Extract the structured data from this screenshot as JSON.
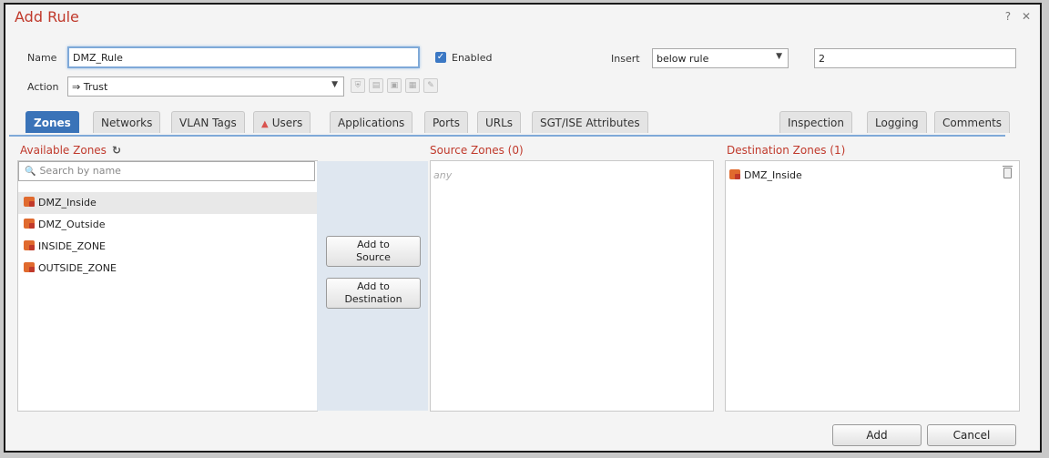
{
  "dialog": {
    "title": "Add Rule",
    "help_label": "?",
    "close_label": "✕"
  },
  "form": {
    "name_label": "Name",
    "name_value": "DMZ_Rule",
    "enabled_label": "Enabled",
    "enabled_checked": true,
    "insert_label": "Insert",
    "insert_value": "below rule",
    "insert_index": "2",
    "action_label": "Action",
    "action_value": "⇒ Trust"
  },
  "tabs": [
    {
      "label": "Zones",
      "active": true
    },
    {
      "label": "Networks"
    },
    {
      "label": "VLAN Tags"
    },
    {
      "label": "Users",
      "warning": true
    },
    {
      "label": "Applications"
    },
    {
      "label": "Ports"
    },
    {
      "label": "URLs"
    },
    {
      "label": "SGT/ISE Attributes"
    },
    {
      "label": "Inspection"
    },
    {
      "label": "Logging"
    },
    {
      "label": "Comments"
    }
  ],
  "available_zones": {
    "header": "Available Zones",
    "search_placeholder": "Search by name",
    "items": [
      "DMZ_Inside",
      "DMZ_Outside",
      "INSIDE_ZONE",
      "OUTSIDE_ZONE"
    ],
    "selected_index": 0
  },
  "middle_buttons": {
    "add_to_source": "Add to\nSource",
    "add_to_destination": "Add to\nDestination"
  },
  "source_zones": {
    "header": "Source Zones (0)",
    "placeholder": "any"
  },
  "destination_zones": {
    "header": "Destination Zones (1)",
    "items": [
      "DMZ_Inside"
    ]
  },
  "footer": {
    "add_label": "Add",
    "cancel_label": "Cancel"
  },
  "colors": {
    "accent": "#3a73b8",
    "header_red": "#c0392b"
  }
}
